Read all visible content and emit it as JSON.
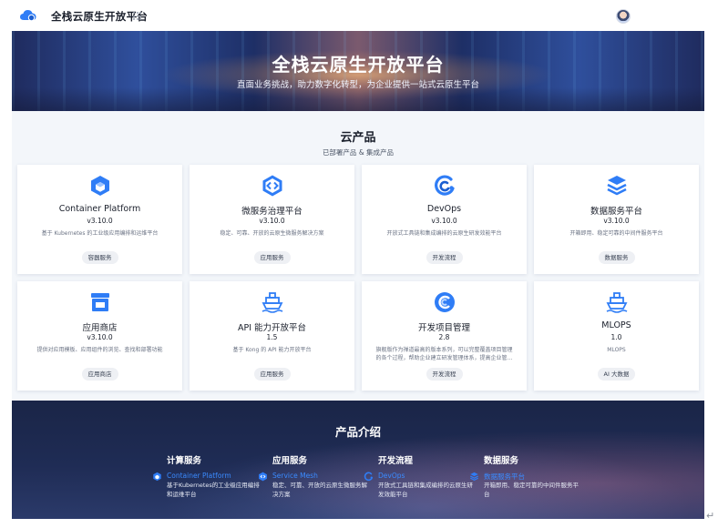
{
  "header": {
    "app_title": "全栈云原生开放平台"
  },
  "hero": {
    "title": "全栈云原生开放平台",
    "subtitle": "直面业务挑战，助力数字化转型，为企业提供一站式云原生平台"
  },
  "products": {
    "title": "云产品",
    "subtitle": "已部署产品 & 集成产品",
    "cards": [
      {
        "name": "Container Platform",
        "version": "v3.10.0",
        "desc": "基于 Kubernetes 的工业级应用编排和运维平台",
        "tag": "容器服务",
        "icon": "cube-icon"
      },
      {
        "name": "微服务治理平台",
        "version": "v3.10.0",
        "desc": "稳定、可靠、开放的云原生微服务解决方案",
        "tag": "应用服务",
        "icon": "hexagon-code-icon"
      },
      {
        "name": "DevOps",
        "version": "v3.10.0",
        "desc": "开放式工具链和集成编排的云原生研发效能平台",
        "tag": "开发流程",
        "icon": "devops-cycle-icon"
      },
      {
        "name": "数据服务平台",
        "version": "v3.10.0",
        "desc": "开箱即用、稳定可靠的中间件服务平台",
        "tag": "数据服务",
        "icon": "layers-icon"
      },
      {
        "name": "应用商店",
        "version": "v3.10.0",
        "desc": "提供对应用模板、应用组件的浏览、查找和部署功能",
        "tag": "应用商店",
        "icon": "store-icon"
      },
      {
        "name": "API 能力开放平台",
        "version": "1.5",
        "desc": "基于 Kong 的 API 能力开放平台",
        "tag": "应用服务",
        "icon": "ship-icon"
      },
      {
        "name": "开发项目管理",
        "version": "2.8",
        "desc": "旗舰版作为禅道最高的版本系列，可以完整覆盖项目管理的各个过程，帮助企业建立研发管理体系，提高企业管…",
        "tag": "开发流程",
        "icon": "swirl-icon"
      },
      {
        "name": "MLOPS",
        "version": "1.0",
        "desc": "MLOPS",
        "tag": "AI 大数据",
        "icon": "ship-icon"
      }
    ]
  },
  "intro": {
    "title": "产品介绍",
    "columns": [
      {
        "head": "计算服务",
        "link": "Container Platform",
        "desc": "基于Kubernetes的工业级应用编排和运维平台"
      },
      {
        "head": "应用服务",
        "link": "Service Mesh",
        "desc": "稳定、可靠、开放的云原生微服务解决方案"
      },
      {
        "head": "开发流程",
        "link": "DevOps",
        "desc": "开放式工具链和集成编排的云原生研发效能平台"
      },
      {
        "head": "数据服务",
        "link": "数据服务平台",
        "desc": "开箱即用、稳定可靠的中间件服务平台"
      }
    ]
  },
  "colors": {
    "accent": "#2f7df6",
    "link": "#3a8bff",
    "intro_bg": "#1f2c55"
  }
}
